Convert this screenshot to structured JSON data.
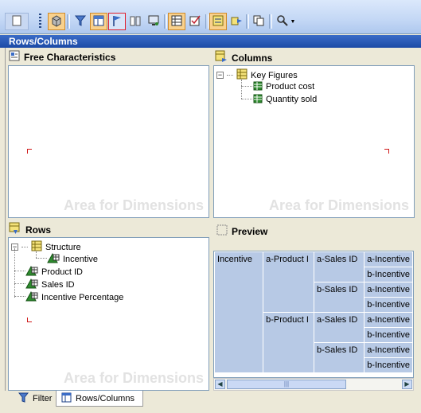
{
  "toolbar": {
    "buttons": [
      {
        "name": "page-button",
        "icon": "page-icon"
      },
      {
        "name": "cube-button",
        "icon": "cube-icon",
        "active": true
      },
      {
        "name": "filter-button",
        "icon": "filter-icon"
      },
      {
        "name": "layout-button",
        "icon": "layout-icon",
        "active": true
      },
      {
        "name": "flag-button",
        "icon": "flag-icon",
        "highlighted": true
      },
      {
        "name": "columns-button",
        "icon": "columns-icon"
      },
      {
        "name": "monitor-button",
        "icon": "monitor-icon"
      },
      {
        "name": "grid-button",
        "icon": "grid-icon",
        "active": true
      },
      {
        "name": "checklist-button",
        "icon": "checklist-icon"
      },
      {
        "name": "navigation-button",
        "icon": "navigation-icon",
        "active": true
      },
      {
        "name": "export-button",
        "icon": "export-icon"
      },
      {
        "name": "copy-button",
        "icon": "copy-icon"
      },
      {
        "name": "tools-dropdown-button",
        "icon": "tools-icon"
      }
    ]
  },
  "window": {
    "title": "Rows/Columns"
  },
  "free_characteristics": {
    "title": "Free Characteristics",
    "watermark": "Area for Dimensions"
  },
  "columns": {
    "title": "Columns",
    "watermark": "Area for Dimensions",
    "tree": {
      "root": "Key Figures",
      "children": [
        "Product cost",
        "Quantity sold"
      ]
    }
  },
  "rows": {
    "title": "Rows",
    "watermark": "Area for Dimensions",
    "tree": {
      "structure": "Structure",
      "structure_child": "Incentive",
      "items": [
        "Product ID",
        "Sales ID",
        "Incentive Percentage"
      ]
    }
  },
  "preview": {
    "title": "Preview",
    "header": "Incentive",
    "products": [
      "a-Product I",
      "b-Product I"
    ],
    "sales": [
      "a-Sales ID",
      "b-Sales ID",
      "a-Sales ID",
      "b-Sales ID"
    ],
    "incentives": [
      "a-Incentive",
      "b-Incentive",
      "a-Incentive",
      "b-Incentive",
      "a-Incentive",
      "b-Incentive",
      "a-Incentive",
      "b-Incentive"
    ],
    "scroll_left": "◀",
    "scroll_right": "▶",
    "thumb_grip": "|||"
  },
  "tabs": [
    {
      "label": "Filter",
      "icon": "filter-icon",
      "active": false
    },
    {
      "label": "Rows/Columns",
      "icon": "table-icon",
      "active": true
    }
  ]
}
